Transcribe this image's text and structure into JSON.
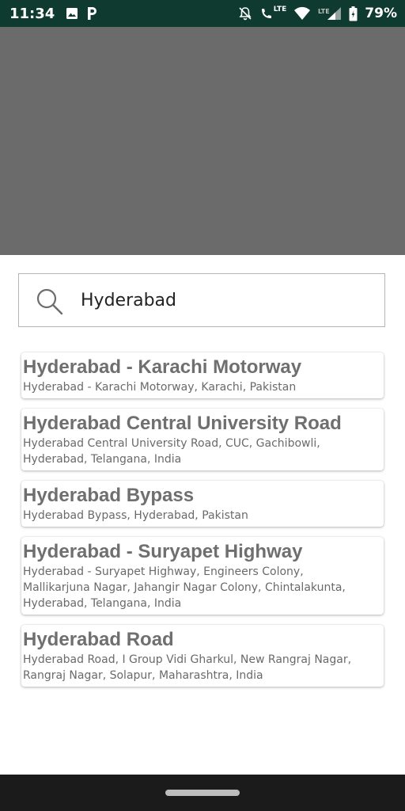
{
  "status_bar": {
    "time": "11:34",
    "left_icons": [
      "image-icon",
      "parking-p-icon"
    ],
    "right_icons": [
      "notifications-off-icon",
      "phone-lte-icon",
      "wifi-icon",
      "lte-signal-icon",
      "battery-icon"
    ],
    "lte_label": "LTE",
    "battery_percent": "79%"
  },
  "search": {
    "value": "Hyderabad",
    "icon": "search-icon"
  },
  "results": [
    {
      "title": "Hyderabad - Karachi Motorway",
      "subtitle_lines": [
        "Hyderabad - Karachi Motorway, Karachi, Pakistan"
      ]
    },
    {
      "title": "Hyderabad Central University Road",
      "subtitle_lines": [
        "Hyderabad Central University Road, CUC, Gachibowli,",
        "Hyderabad, Telangana, India"
      ]
    },
    {
      "title": "Hyderabad Bypass",
      "subtitle_lines": [
        "Hyderabad Bypass, Hyderabad, Pakistan"
      ]
    },
    {
      "title": "Hyderabad - Suryapet Highway",
      "subtitle_lines": [
        "Hyderabad - Suryapet Highway, Engineers Colony,",
        "Mallikarjuna Nagar, Jahangir Nagar Colony, Chintalakunta,",
        "Hyderabad, Telangana, India"
      ]
    },
    {
      "title": "Hyderabad Road",
      "subtitle_lines": [
        "Hyderabad Road, I Group Vidi Gharkul, New Rangraj Nagar,",
        "Rangraj Nagar, Solapur, Maharashtra, India"
      ]
    }
  ],
  "colors": {
    "status_bar_bg": "#0e3a2f",
    "scrim": "#6b6b6b",
    "title_text": "#6f6f6f",
    "nav_bar_bg": "#1b1b1b"
  }
}
